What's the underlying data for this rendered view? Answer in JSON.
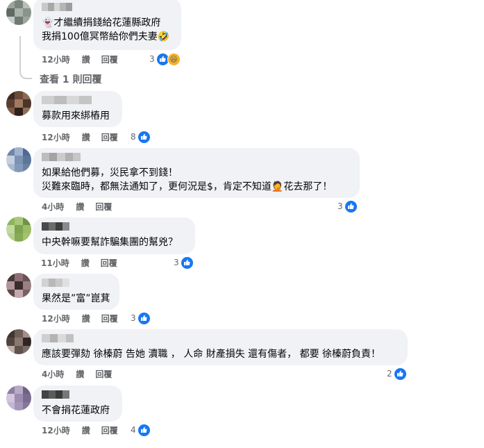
{
  "comments": [
    {
      "lines": [
        "👻才繼續捐錢給花蓮縣政府",
        "我捐100億冥幣給你們夫妻🤣"
      ],
      "time": "12小時",
      "like": "讚",
      "reply": "回覆",
      "reactions": "3",
      "reaction_icons": [
        "like-icon",
        "haha-icon"
      ],
      "avatar_colors": [
        "#9aa39a",
        "#7c857d",
        "#b8c0b8",
        "#5f6a62",
        "#a9b2ab",
        "#8a948c",
        "#c7ccc8",
        "#6f7a73",
        "#9ea79f"
      ],
      "name_colors": [
        "#c9c9c9",
        "#a8a8a8",
        "#d6d6d6",
        "#b5b5b5",
        "#9d9d9d"
      ]
    },
    {
      "lines": [
        "募款用來綁樁用"
      ],
      "time": "12小時",
      "like": "讚",
      "reply": "回覆",
      "reactions": "8",
      "reaction_icons": [
        "like-icon"
      ],
      "avatar_colors": [
        "#3d2b22",
        "#6b4a38",
        "#8c6a55",
        "#5a3e2f",
        "#a07a60",
        "#4b3428",
        "#7d5a44",
        "#2f2019",
        "#936f57"
      ],
      "name_colors": [
        "#cfcfcf",
        "#bdbdbd",
        "#d8d8d8",
        "#c4c4c4"
      ]
    },
    {
      "lines": [
        "如果給他們募，災民拿不到錢！",
        "災難來臨時，都無法通知了，更何況是$，肯定不知道🤦花去那了！"
      ],
      "time": "4小時",
      "like": "讚",
      "reply": "回覆",
      "reactions": "3",
      "reaction_icons": [
        "like-icon"
      ],
      "avatar_colors": [
        "#6d86a8",
        "#9fb3cf",
        "#4e6a90",
        "#c3d0e2",
        "#7a93b5",
        "#5b7699",
        "#aab9d0",
        "#8299ba",
        "#6a82a3"
      ],
      "name_colors": [
        "#bdbdbd",
        "#a3a3a3",
        "#cbcbcb",
        "#b0b0b0",
        "#c6c6c6"
      ]
    },
    {
      "lines": [
        "中央幹嘛要幫詐騙集團的幫兇？"
      ],
      "time": "11小時",
      "like": "讚",
      "reply": "回覆",
      "reactions": "3",
      "reaction_icons": [
        "like-icon"
      ],
      "avatar_colors": [
        "#8fb35a",
        "#a9c77a",
        "#6f9443",
        "#c2d9a0",
        "#7fa34e",
        "#9bbd68",
        "#b5d08d",
        "#86aa55",
        "#a2c270"
      ],
      "name_colors": [
        "#4a4a4a",
        "#6b6b6b",
        "#3e3e3e",
        "#8a8a8a"
      ]
    },
    {
      "lines": [
        "果然是”富”崑萁"
      ],
      "time": "12小時",
      "like": "讚",
      "reply": "回覆",
      "reactions": "3",
      "reaction_icons": [
        "like-icon"
      ],
      "avatar_colors": [
        "#4a3a3c",
        "#8d6f74",
        "#6b5256",
        "#b0959a",
        "#3b2c2e",
        "#9a7f83",
        "#5e474a",
        "#c2a9ad",
        "#7a6064"
      ],
      "name_colors": [
        "#d2d2d2",
        "#b8b8b8",
        "#c9c9c9",
        "#e0e0e0"
      ]
    },
    {
      "lines": [
        "應該要彈劾 徐榛蔚 告她 瀆職 ， 人命 財產損失 還有傷者， 都要 徐榛蔚負責！"
      ],
      "time": "4小時",
      "like": "讚",
      "reply": "回覆",
      "reactions": "2",
      "reaction_icons": [
        "like-icon"
      ],
      "avatar_colors": [
        "#3f3532",
        "#6e5e58",
        "#a38f86",
        "#51443f",
        "#8a7770",
        "#2e2624",
        "#c0ada5",
        "#5f514c",
        "#7c6b65"
      ],
      "name_colors": [
        "#cfcfcf",
        "#b3b3b3",
        "#dadada",
        "#c1c1c1"
      ]
    },
    {
      "lines": [
        "不會捐花蓮政府"
      ],
      "time": "12小時",
      "like": "讚",
      "reply": "回覆",
      "reactions": "4",
      "reaction_icons": [
        "like-icon"
      ],
      "avatar_colors": [
        "#8e7fa0",
        "#b8a9c9",
        "#6e6185",
        "#d1c6de",
        "#9c8caf",
        "#7a6c91",
        "#c4b6d3",
        "#a595b8",
        "#85779b"
      ],
      "name_colors": [
        "#444444",
        "#5c5c5c",
        "#3a3a3a",
        "#777777"
      ]
    }
  ],
  "view_replies": "查看 1 則回覆"
}
